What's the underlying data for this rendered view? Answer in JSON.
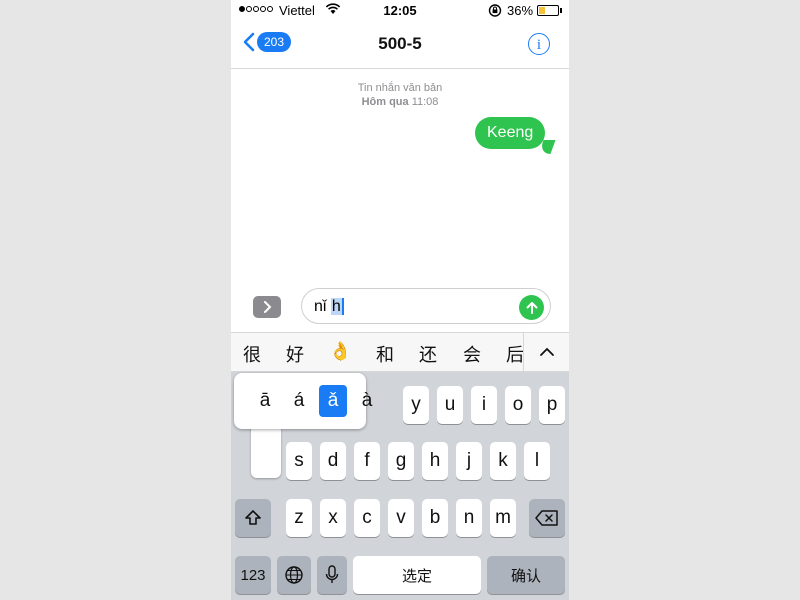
{
  "status": {
    "carrier": "Viettel",
    "time": "12:05",
    "battery": "36%",
    "battery_level": 0.36
  },
  "nav": {
    "back_count": "203",
    "title": "500-5",
    "info": "i"
  },
  "conversation": {
    "meta_line1": "Tin nhắn văn bản",
    "meta_day": "Hôm qua",
    "meta_time": "11:08",
    "message": "Keeng"
  },
  "input": {
    "prefix": "nǐ",
    "selected": "h"
  },
  "candidates": [
    "很",
    "好",
    "👌",
    "和",
    "还",
    "会",
    "后"
  ],
  "keyboard": {
    "row1": [
      "y",
      "u",
      "i",
      "o",
      "p"
    ],
    "row2": [
      "s",
      "d",
      "f",
      "g",
      "h",
      "j",
      "k",
      "l"
    ],
    "row3": [
      "z",
      "x",
      "c",
      "v",
      "b",
      "n",
      "m"
    ],
    "numbers_label": "123",
    "space_label": "选定",
    "confirm_label": "确认"
  },
  "popup": {
    "options": [
      "ā",
      "á",
      "ǎ",
      "à"
    ],
    "selected_index": 2
  },
  "colors": {
    "accent": "#1a7cf5",
    "bubble": "#2fc44f"
  }
}
